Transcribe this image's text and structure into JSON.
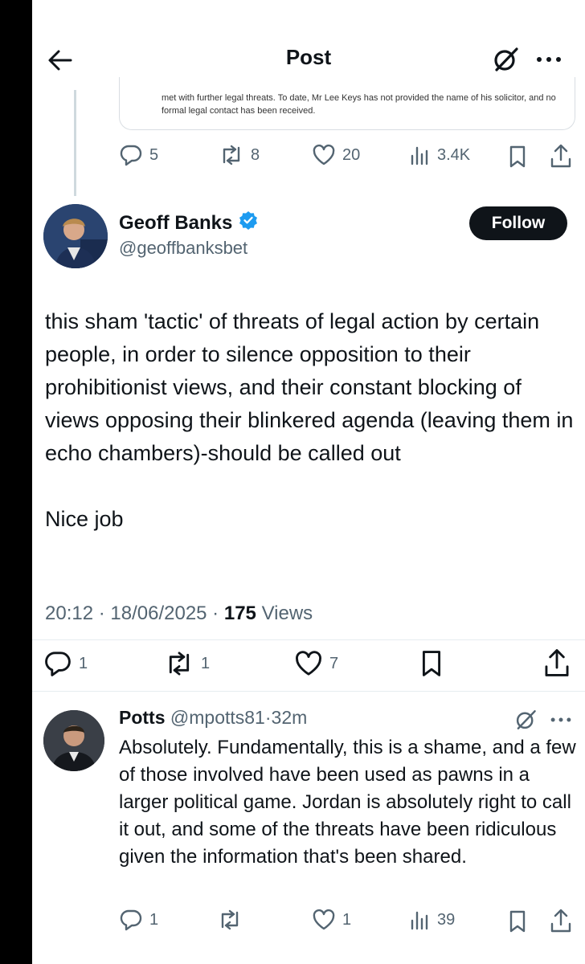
{
  "header": {
    "title": "Post"
  },
  "quoted": {
    "text": "met with further legal threats. To date, Mr Lee Keys has not provided the name of his solicitor, and no formal legal contact has been received.",
    "stats": {
      "replies": "5",
      "reposts": "8",
      "likes": "20",
      "views": "3.4K"
    }
  },
  "post": {
    "author_name": "Geoff Banks",
    "handle": "@geoffbanksbet",
    "follow_label": "Follow",
    "paragraphs": [
      "this sham 'tactic' of threats of legal action by certain people, in order to silence opposition to their prohibitionist views, and their constant blocking of views opposing their blinkered agenda (leaving them in echo chambers)-should be called out",
      "Nice job"
    ],
    "time": "20:12",
    "date": "18/06/2025",
    "views_count": "175",
    "views_label": "Views",
    "stats": {
      "replies": "1",
      "reposts": "1",
      "likes": "7"
    }
  },
  "reply": {
    "author_name": "Potts",
    "handle": "@mpotts81",
    "age": "32m",
    "text": "Absolutely. Fundamentally, this is a shame, and a few of those involved have been used as pawns in a larger political game. Jordan is absolutely right to call it out, and some of the threats have been ridiculous given the information that's been shared.",
    "stats": {
      "replies": "1",
      "likes": "1",
      "views": "39"
    }
  },
  "colors": {
    "text": "#0f1419",
    "secondary": "#536471",
    "verified": "#1d9bf0",
    "follow_bg": "#0f1419"
  },
  "icons": [
    "back-arrow-icon",
    "grok-icon",
    "more-icon",
    "reply-icon",
    "repost-icon",
    "like-icon",
    "views-icon",
    "bookmark-icon",
    "share-icon",
    "verified-badge-icon"
  ]
}
